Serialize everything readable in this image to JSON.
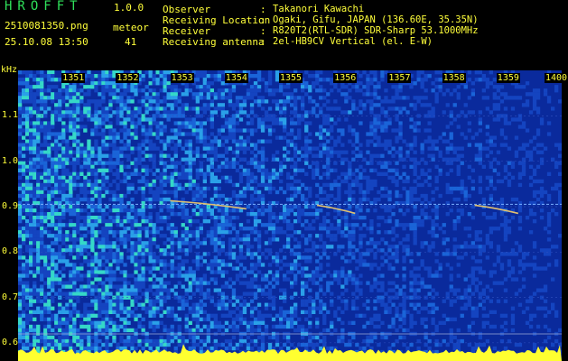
{
  "header": {
    "app_title": "HROFFT",
    "app_version": "1.0.0",
    "file_name": "2510081350.png",
    "meteor_label": "meteor",
    "timestamp": "25.10.08 13:50",
    "meteor_count": "41",
    "info": [
      {
        "label": "Observer",
        "value": "Takanori Kawachi"
      },
      {
        "label": "Receiving Location",
        "value": "Ogaki, Gifu, JAPAN (136.60E, 35.35N)"
      },
      {
        "label": "Receiver",
        "value": "R820T2(RTL-SDR) SDR-Sharp 53.1000MHz"
      },
      {
        "label": "Receiving antenna",
        "value": "2el-HB9CV Vertical (el. E-W)"
      }
    ]
  },
  "colors": {
    "text_yellow": "#ffff3a",
    "title_green": "#2fe05a",
    "background": "#000000",
    "spectrum_base": "#0a2a9c",
    "baseline_yellow": "#ffff30",
    "meteor_trace": "#e0c070"
  },
  "chart_data": {
    "type": "heatmap",
    "ylabel": "kHz",
    "x_ticks": [
      "1351",
      "1352",
      "1353",
      "1354",
      "1355",
      "1356",
      "1357",
      "1358",
      "1359",
      "1400"
    ],
    "x_tick_minutes": [
      1,
      2,
      3,
      4,
      5,
      6,
      7,
      8,
      9,
      10
    ],
    "xlim_minutes": [
      0,
      10
    ],
    "y_ticks": [
      "1.1",
      "1.0",
      "0.9",
      "0.8",
      "0.7",
      "0.6"
    ],
    "y_tick_values": [
      1.1,
      1.0,
      0.9,
      0.8,
      0.7,
      0.6
    ],
    "ylim_khz": [
      0.56,
      1.2
    ],
    "carrier_khz": 0.905,
    "meteor_echoes": [
      {
        "start_min": 2.8,
        "end_min": 4.2,
        "khz": 0.905
      },
      {
        "start_min": 5.5,
        "end_min": 6.2,
        "khz": 0.895
      },
      {
        "start_min": 8.4,
        "end_min": 9.2,
        "khz": 0.895
      }
    ]
  }
}
